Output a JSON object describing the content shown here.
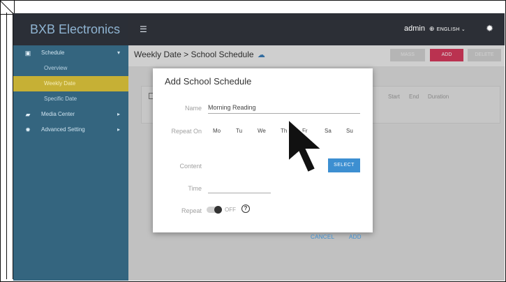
{
  "sidebar": {
    "brand": "BXB Electronics",
    "items": [
      {
        "label": "Schedule",
        "icon": "calendar-icon"
      },
      {
        "label": "Overview"
      },
      {
        "label": "Weekly Date"
      },
      {
        "label": "Specific Date"
      },
      {
        "label": "Media Center",
        "icon": "folder-icon"
      },
      {
        "label": "Advanced Setting",
        "icon": "gear-icon"
      }
    ]
  },
  "topbar": {
    "user": "admin",
    "language": "ENGLISH",
    "icons": [
      "menu-icon",
      "globe-icon",
      "chevron-down-icon",
      "gear-icon"
    ]
  },
  "page": {
    "breadcrumb": "Weekly Date  >  School Schedule",
    "buttons": {
      "mass": "MASS",
      "add": "ADD",
      "delete": "DELETE"
    },
    "columns": [
      "Start",
      "End",
      "Duration"
    ]
  },
  "dialog": {
    "title": "Add School Schedule",
    "name_label": "Name",
    "name_value": "Morning Reading",
    "repeat_on_label": "Repeat On",
    "days": [
      "Mo",
      "Tu",
      "We",
      "Th",
      "Fr",
      "Sa",
      "Su"
    ],
    "content_label": "Content",
    "select_button": "SELECT",
    "time_label": "Time",
    "repeat_label": "Repeat",
    "repeat_state": "OFF",
    "help": "?",
    "cancel": "CANCEL",
    "add": "ADD"
  },
  "colors": {
    "sidebar": "#34657f",
    "topbar": "#2c2f36",
    "active_nav": "#c6b035",
    "add_button": "#d43a5c",
    "primary": "#3d8fd1"
  }
}
